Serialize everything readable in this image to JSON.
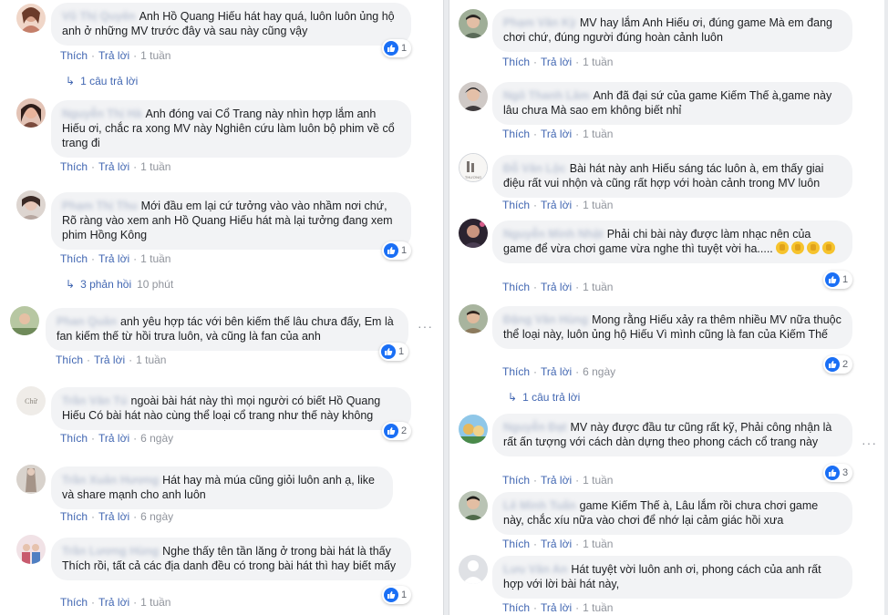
{
  "labels": {
    "like": "Thích",
    "reply": "Trả lời"
  },
  "left": [
    {
      "name": "Vũ Thị Quyên",
      "text": "Anh Hồ Quang Hiếu hát hay quá, luôn luôn ủng hộ anh ở những MV trước đây và sau này cũng vậy",
      "time": "1 tuần",
      "likes": "1",
      "replies": "1 câu trả lời",
      "replies_time": "",
      "avatar": "#d9a48c"
    },
    {
      "name": "Nguyễn Thị Hà",
      "text": "Anh đóng vai Cổ Trang này nhìn hợp lắm anh Hiếu ơi, chắc ra xong MV này Nghiên cứu làm luôn bộ phim về cổ trang đi",
      "time": "1 tuần",
      "likes": "",
      "replies": "",
      "replies_time": "",
      "avatar": "#7a4b3d"
    },
    {
      "name": "Phạm Thị Thu",
      "text": "Mới đầu em lại cứ tưởng vào vào nhầm nơi chứ, Rõ ràng vào xem anh Hồ Quang Hiếu hát mà lại tưởng đang xem phim Hồng Kông",
      "time": "1 tuần",
      "likes": "1",
      "replies": "3 phản hồi",
      "replies_time": "10 phút",
      "avatar": "#b7a7a0"
    },
    {
      "name": "Phan Quân",
      "text": "anh yêu hợp tác với bên kiếm thế lâu chưa đấy, Em là fan kiếm thế từ hồi trưa luôn, và cũng là fan của anh",
      "time": "1 tuần",
      "likes": "1",
      "replies": "",
      "replies_time": "",
      "avatar": "#8aa07a"
    },
    {
      "name": "Trần Văn Tú",
      "text": "ngoài bài hát này thì mọi người có biết Hồ Quang Hiếu Có bài hát nào cùng thể loại cổ trang như thế này không",
      "time": "6 ngày",
      "likes": "2",
      "replies": "",
      "replies_time": "",
      "avatar": "#cfcac2"
    },
    {
      "name": "Trần Xuân Hương",
      "text": "Hát hay mà múa cũng giỏi luôn anh ạ, like và share mạnh cho anh luôn",
      "time": "6 ngày",
      "likes": "",
      "replies": "",
      "replies_time": "",
      "avatar": "#a59488"
    },
    {
      "name": "Trần Lương Hùng",
      "text": "Nghe thấy tên tần lăng ở trong bài hát là thấy Thích rồi, tất cả các địa danh đều có trong bài hát thì hay biết mấy",
      "time": "1 tuần",
      "likes": "1",
      "replies": "",
      "replies_time": "",
      "avatar": "#c85b6e"
    }
  ],
  "right": [
    {
      "name": "Phạm Văn Kỳ",
      "text": "MV hay lắm Anh Hiếu ơi, đúng game Mà em đang chơi chứ, đúng người đúng hoàn cảnh luôn",
      "time": "1 tuần",
      "likes": "",
      "replies": "",
      "replies_time": "",
      "avatar": "#5a6a58"
    },
    {
      "name": "Ngô Thanh Lâm",
      "text": "Anh đã đại sứ của game Kiếm Thế à,game này lâu chưa Mà sao em không biết nhỉ",
      "time": "1 tuần",
      "likes": "",
      "replies": "",
      "replies_time": "",
      "avatar": "#3e3a3c"
    },
    {
      "name": "Đỗ Văn Lộc",
      "text": "Bài hát này anh Hiếu sáng tác luôn à, em thấy giai điệu rất vui nhộn và cũng rất hợp với hoàn cảnh trong MV luôn",
      "time": "1 tuần",
      "likes": "",
      "replies": "",
      "replies_time": "",
      "avatar": "#e8e6e3"
    },
    {
      "name": "Nguyễn Minh Nhật",
      "text": "Phải chi bài này được làm nhạc nên của game để vừa chơi game vừa nghe thì tuyệt vời ha.....",
      "time": "1 tuần",
      "likes": "1",
      "replies": "",
      "replies_time": "",
      "avatar": "#4a3d52"
    },
    {
      "name": "Đặng Văn Hùng",
      "text": "Mong rằng Hiếu xảy ra thêm nhiều MV nữa thuộc thể loại này, luôn ủng hộ Hiếu Vì mình cũng là fan của Kiếm Thế",
      "time": "6 ngày",
      "likes": "2",
      "replies": "1 câu trả lời",
      "replies_time": "",
      "avatar": "#8c7a5d"
    },
    {
      "name": "Nguyễn Đạt",
      "text": "MV này được đầu tư cũng rất kỹ, Phải công nhận là rất ấn tượng với cách dàn dựng theo phong cách cổ trang này",
      "time": "1 tuần",
      "likes": "3",
      "replies": "",
      "replies_time": "",
      "avatar": "#e6b85c"
    },
    {
      "name": "Lê Minh Tuấn",
      "text": "game Kiếm Thế à, Lâu lắm rồi chưa chơi game này, chắc xíu nữa vào chơi để nhớ lại cảm giác hồi xưa",
      "time": "1 tuần",
      "likes": "",
      "replies": "",
      "replies_time": "",
      "avatar": "#4f6a4a"
    },
    {
      "name": "Lưu Văn An",
      "text": "Hát tuyệt vời luôn anh ơi, phong cách của anh rất hợp với lời bài hát này,",
      "time": "1 tuần",
      "likes": "",
      "replies": "",
      "replies_time": "",
      "avatar": "#c9ccd1"
    }
  ]
}
